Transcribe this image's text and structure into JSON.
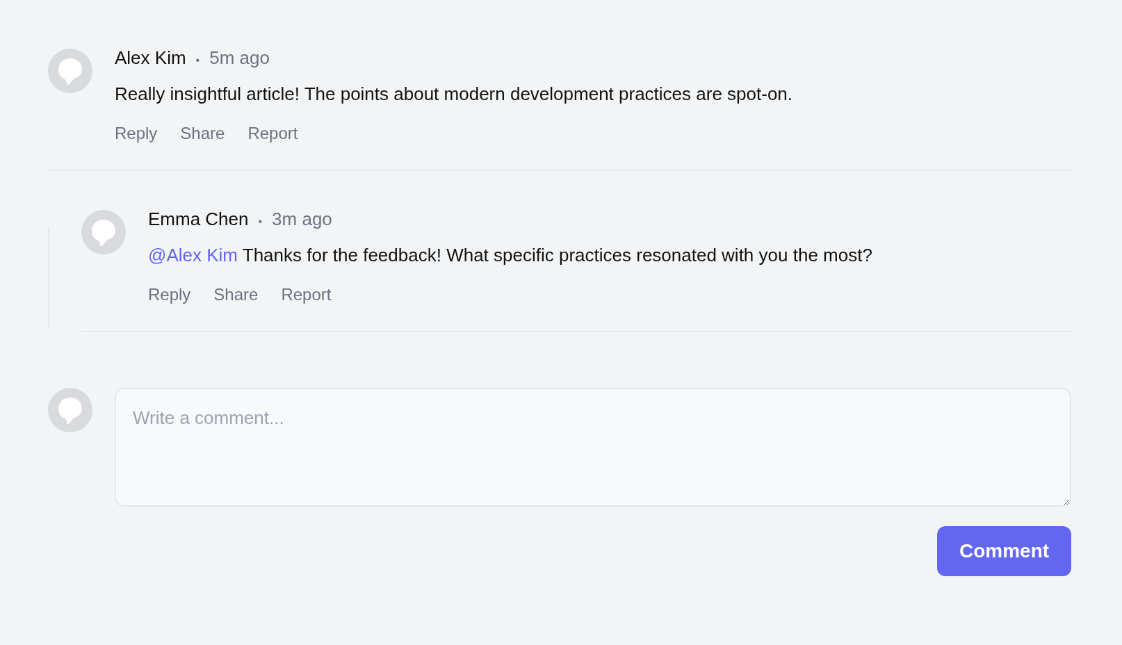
{
  "comments": [
    {
      "author": "Alex Kim",
      "separator": "•",
      "time": "5m ago",
      "text": "Really insightful article! The points about modern development practices are spot-on.",
      "actions": [
        "Reply",
        "Share",
        "Report"
      ],
      "children": [
        {
          "author": "Emma Chen",
          "separator": "•",
          "time": "3m ago",
          "mention": "@Alex Kim",
          "text": "Thanks for the feedback! What specific practices resonated with you the most?",
          "actions": [
            "Reply",
            "Share",
            "Report"
          ]
        }
      ]
    }
  ],
  "composer": {
    "placeholder": "Write a comment...",
    "button": "Comment"
  }
}
